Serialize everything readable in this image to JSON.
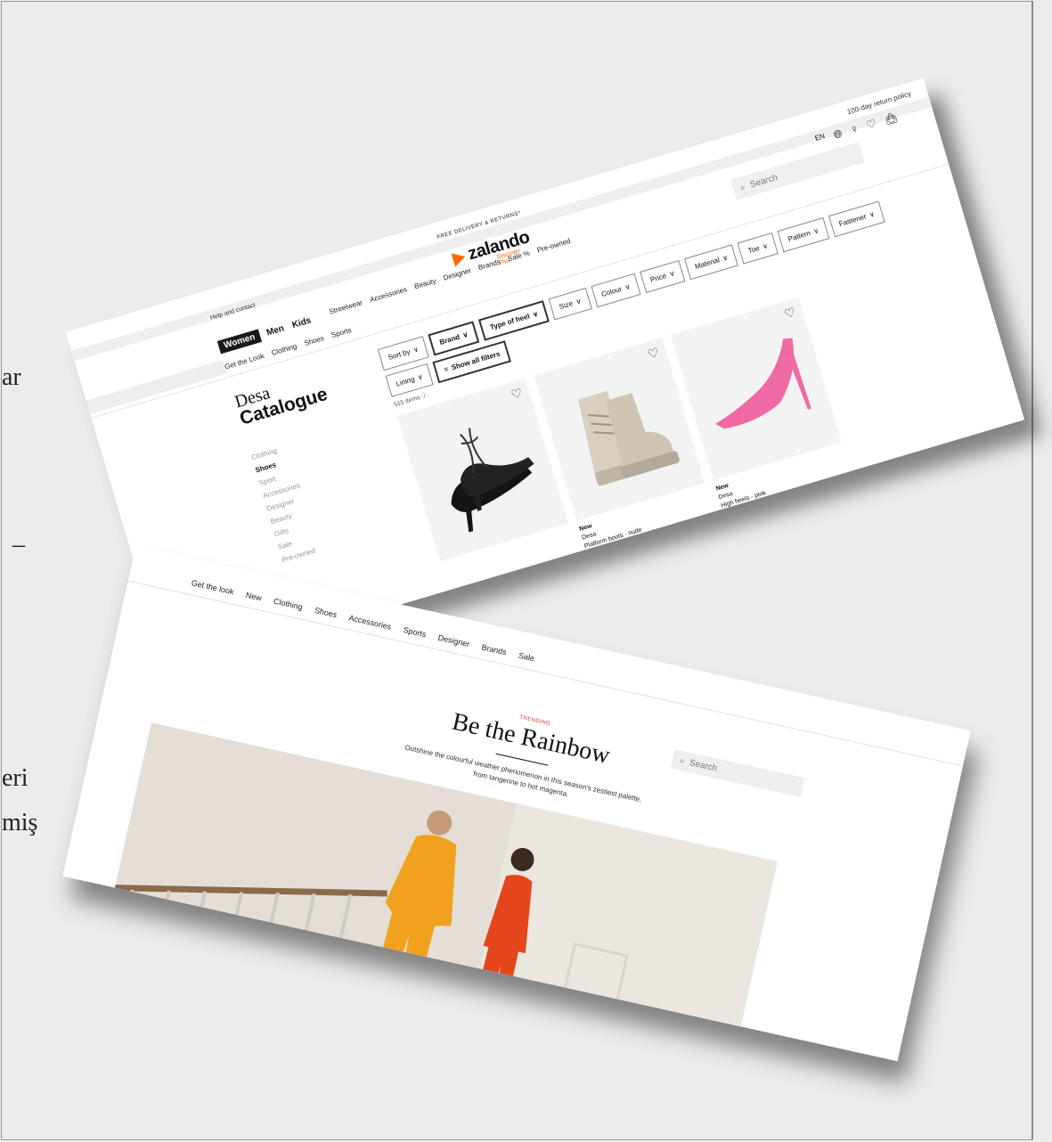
{
  "background_fragments": [
    "ar",
    "–",
    "eri",
    "miş"
  ],
  "catalogue": {
    "top_strip": {
      "returns": "100-day return policy",
      "free_delivery": "FREE DELIVERY & RETURNS*",
      "help": "Help and contact"
    },
    "logo": {
      "word": "zalando",
      "plus": "Discover Plus"
    },
    "lang": "EN",
    "search_placeholder": "Search",
    "gender_tabs": [
      "Women",
      "Men",
      "Kids"
    ],
    "categories": [
      "Get the Look",
      "Clothing",
      "Shoes",
      "Sports",
      "Streetwear",
      "Accessories",
      "Beauty",
      "Designer",
      "Brands",
      "Sale %",
      "Pre-owned"
    ],
    "title_line1": "Desa",
    "title_line2": "Catalogue",
    "filters": [
      "Sort by",
      "Brand",
      "Type of heel",
      "Size",
      "Colour",
      "Price",
      "Material",
      "Toe",
      "Pattern",
      "Fastener",
      "Lining",
      "Show all filters"
    ],
    "item_count": "515 items",
    "side_nav": [
      "Clothing",
      "Shoes",
      "Sport",
      "Accessories",
      "Designer",
      "Beauty",
      "Gifts",
      "Sale",
      "Pre-owned"
    ],
    "products": [
      {
        "badge": "",
        "brand": "",
        "name": ""
      },
      {
        "badge": "New",
        "brand": "Desa",
        "name": "Platform boots - nude"
      },
      {
        "badge": "New",
        "brand": "Desa",
        "name": "High heels - pink"
      }
    ]
  },
  "editorial": {
    "nav": [
      "Get the look",
      "New",
      "Clothing",
      "Shoes",
      "Accessories",
      "Sports",
      "Designer",
      "Brands",
      "Sale"
    ],
    "search_placeholder": "Search",
    "eyebrow": "TRENDING",
    "headline": "Be the Rainbow",
    "description_line1": "Outshine the colourful weather phenomenon in this season's zestiest palette,",
    "description_line2": "from tangerine to hot magenta."
  }
}
